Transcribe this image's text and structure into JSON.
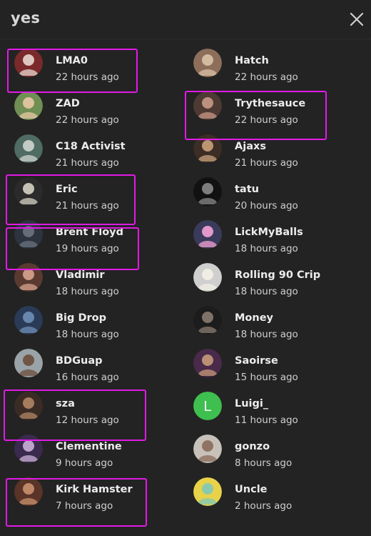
{
  "dialog": {
    "title": "yes",
    "close_icon": "close-icon"
  },
  "colors": {
    "background": "#232323",
    "highlight": "#e21ae6",
    "luigi_avatar": "#3fbf4f"
  },
  "users": [
    {
      "name": "LMA0",
      "time": "22 hours ago",
      "highlighted": true,
      "avatar": {
        "bg": "#7a2a2a",
        "fg": "#e8d8d0"
      }
    },
    {
      "name": "Hatch",
      "time": "22 hours ago",
      "highlighted": false,
      "avatar": {
        "bg": "#8d6e5a",
        "fg": "#d9c3a5"
      }
    },
    {
      "name": "ZAD",
      "time": "22 hours ago",
      "highlighted": false,
      "avatar": {
        "bg": "#6f8f54",
        "fg": "#e9c8a6"
      }
    },
    {
      "name": "Trythesauce",
      "time": "22 hours ago",
      "highlighted": true,
      "avatar": {
        "bg": "#4d3a33",
        "fg": "#c99a86"
      }
    },
    {
      "name": "C18 Activist",
      "time": "21 hours ago",
      "highlighted": false,
      "avatar": {
        "bg": "#4f6b63",
        "fg": "#cfd6cf"
      }
    },
    {
      "name": "Ajaxs",
      "time": "21 hours ago",
      "highlighted": false,
      "avatar": {
        "bg": "#3c2d25",
        "fg": "#c9a27c"
      }
    },
    {
      "name": "Eric",
      "time": "21 hours ago",
      "highlighted": true,
      "avatar": {
        "bg": "#2b2b2b",
        "fg": "#d6d3c4"
      }
    },
    {
      "name": "tatu",
      "time": "20 hours ago",
      "highlighted": false,
      "avatar": {
        "bg": "#111111",
        "fg": "#8a8a8a"
      }
    },
    {
      "name": "Brent Floyd",
      "time": "19 hours ago",
      "highlighted": true,
      "avatar": {
        "bg": "#2d3440",
        "fg": "#6a7380"
      }
    },
    {
      "name": "LickMyBalls",
      "time": "18 hours ago",
      "highlighted": false,
      "avatar": {
        "bg": "#3a3a5a",
        "fg": "#f5a3d6"
      }
    },
    {
      "name": "Vladimir",
      "time": "18 hours ago",
      "highlighted": false,
      "avatar": {
        "bg": "#5a3a30",
        "fg": "#d7a48e"
      }
    },
    {
      "name": "Rolling 90 Crip",
      "time": "18 hours ago",
      "highlighted": false,
      "avatar": {
        "bg": "#cfcfcf",
        "fg": "#f3efe6"
      }
    },
    {
      "name": "Big Drop",
      "time": "18 hours ago",
      "highlighted": false,
      "avatar": {
        "bg": "#2a3b58",
        "fg": "#6f8fb6"
      }
    },
    {
      "name": "Money",
      "time": "18 hours ago",
      "highlighted": false,
      "avatar": {
        "bg": "#1c1c1c",
        "fg": "#8a7c70"
      }
    },
    {
      "name": "BDGuap",
      "time": "16 hours ago",
      "highlighted": false,
      "avatar": {
        "bg": "#9aa3a8",
        "fg": "#6a4e3a"
      }
    },
    {
      "name": "Saoirse",
      "time": "15 hours ago",
      "highlighted": false,
      "avatar": {
        "bg": "#4a2a4a",
        "fg": "#c59a7a"
      }
    },
    {
      "name": "sza",
      "time": "12 hours ago",
      "highlighted": true,
      "avatar": {
        "bg": "#3a2c24",
        "fg": "#b38566"
      }
    },
    {
      "name": "Luigi_",
      "time": "11 hours ago",
      "highlighted": false,
      "avatar": {
        "bg": "#3fbf4f",
        "fg": "#ffffff",
        "letter": "L"
      }
    },
    {
      "name": "Clementine",
      "time": "9 hours ago",
      "highlighted": false,
      "avatar": {
        "bg": "#3a2a4e",
        "fg": "#cbb0d8"
      }
    },
    {
      "name": "gonzo",
      "time": "8 hours ago",
      "highlighted": false,
      "avatar": {
        "bg": "#c7c1ba",
        "fg": "#8a6c5a"
      }
    },
    {
      "name": "Kirk Hamster",
      "time": "7 hours ago",
      "highlighted": true,
      "avatar": {
        "bg": "#5a3428",
        "fg": "#c9906e"
      }
    },
    {
      "name": "Uncle",
      "time": "2 hours ago",
      "highlighted": false,
      "avatar": {
        "bg": "#e7d24a",
        "fg": "#7fc8b8"
      }
    }
  ]
}
